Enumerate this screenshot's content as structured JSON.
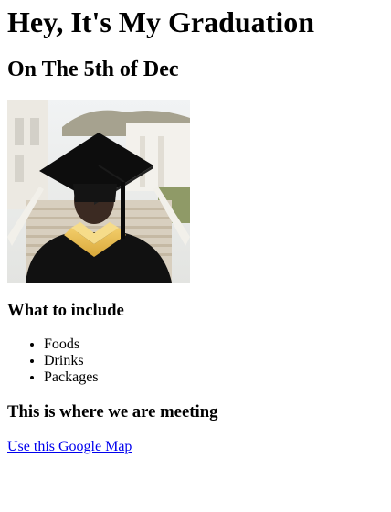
{
  "heading": "Hey, It's My Graduation",
  "subheading": "On The 5th of Dec",
  "photo": {
    "subject": "graduate-in-cap-and-gown-back-view"
  },
  "include_section": {
    "title": "What to include",
    "items": [
      "Foods",
      "Drinks",
      "Packages"
    ]
  },
  "meeting_section": {
    "title": "This is where we are meeting",
    "link_label": "Use this Google Map"
  },
  "colors": {
    "link": "#0000ee",
    "gown": "#111111",
    "stole": "#e6b84a"
  }
}
